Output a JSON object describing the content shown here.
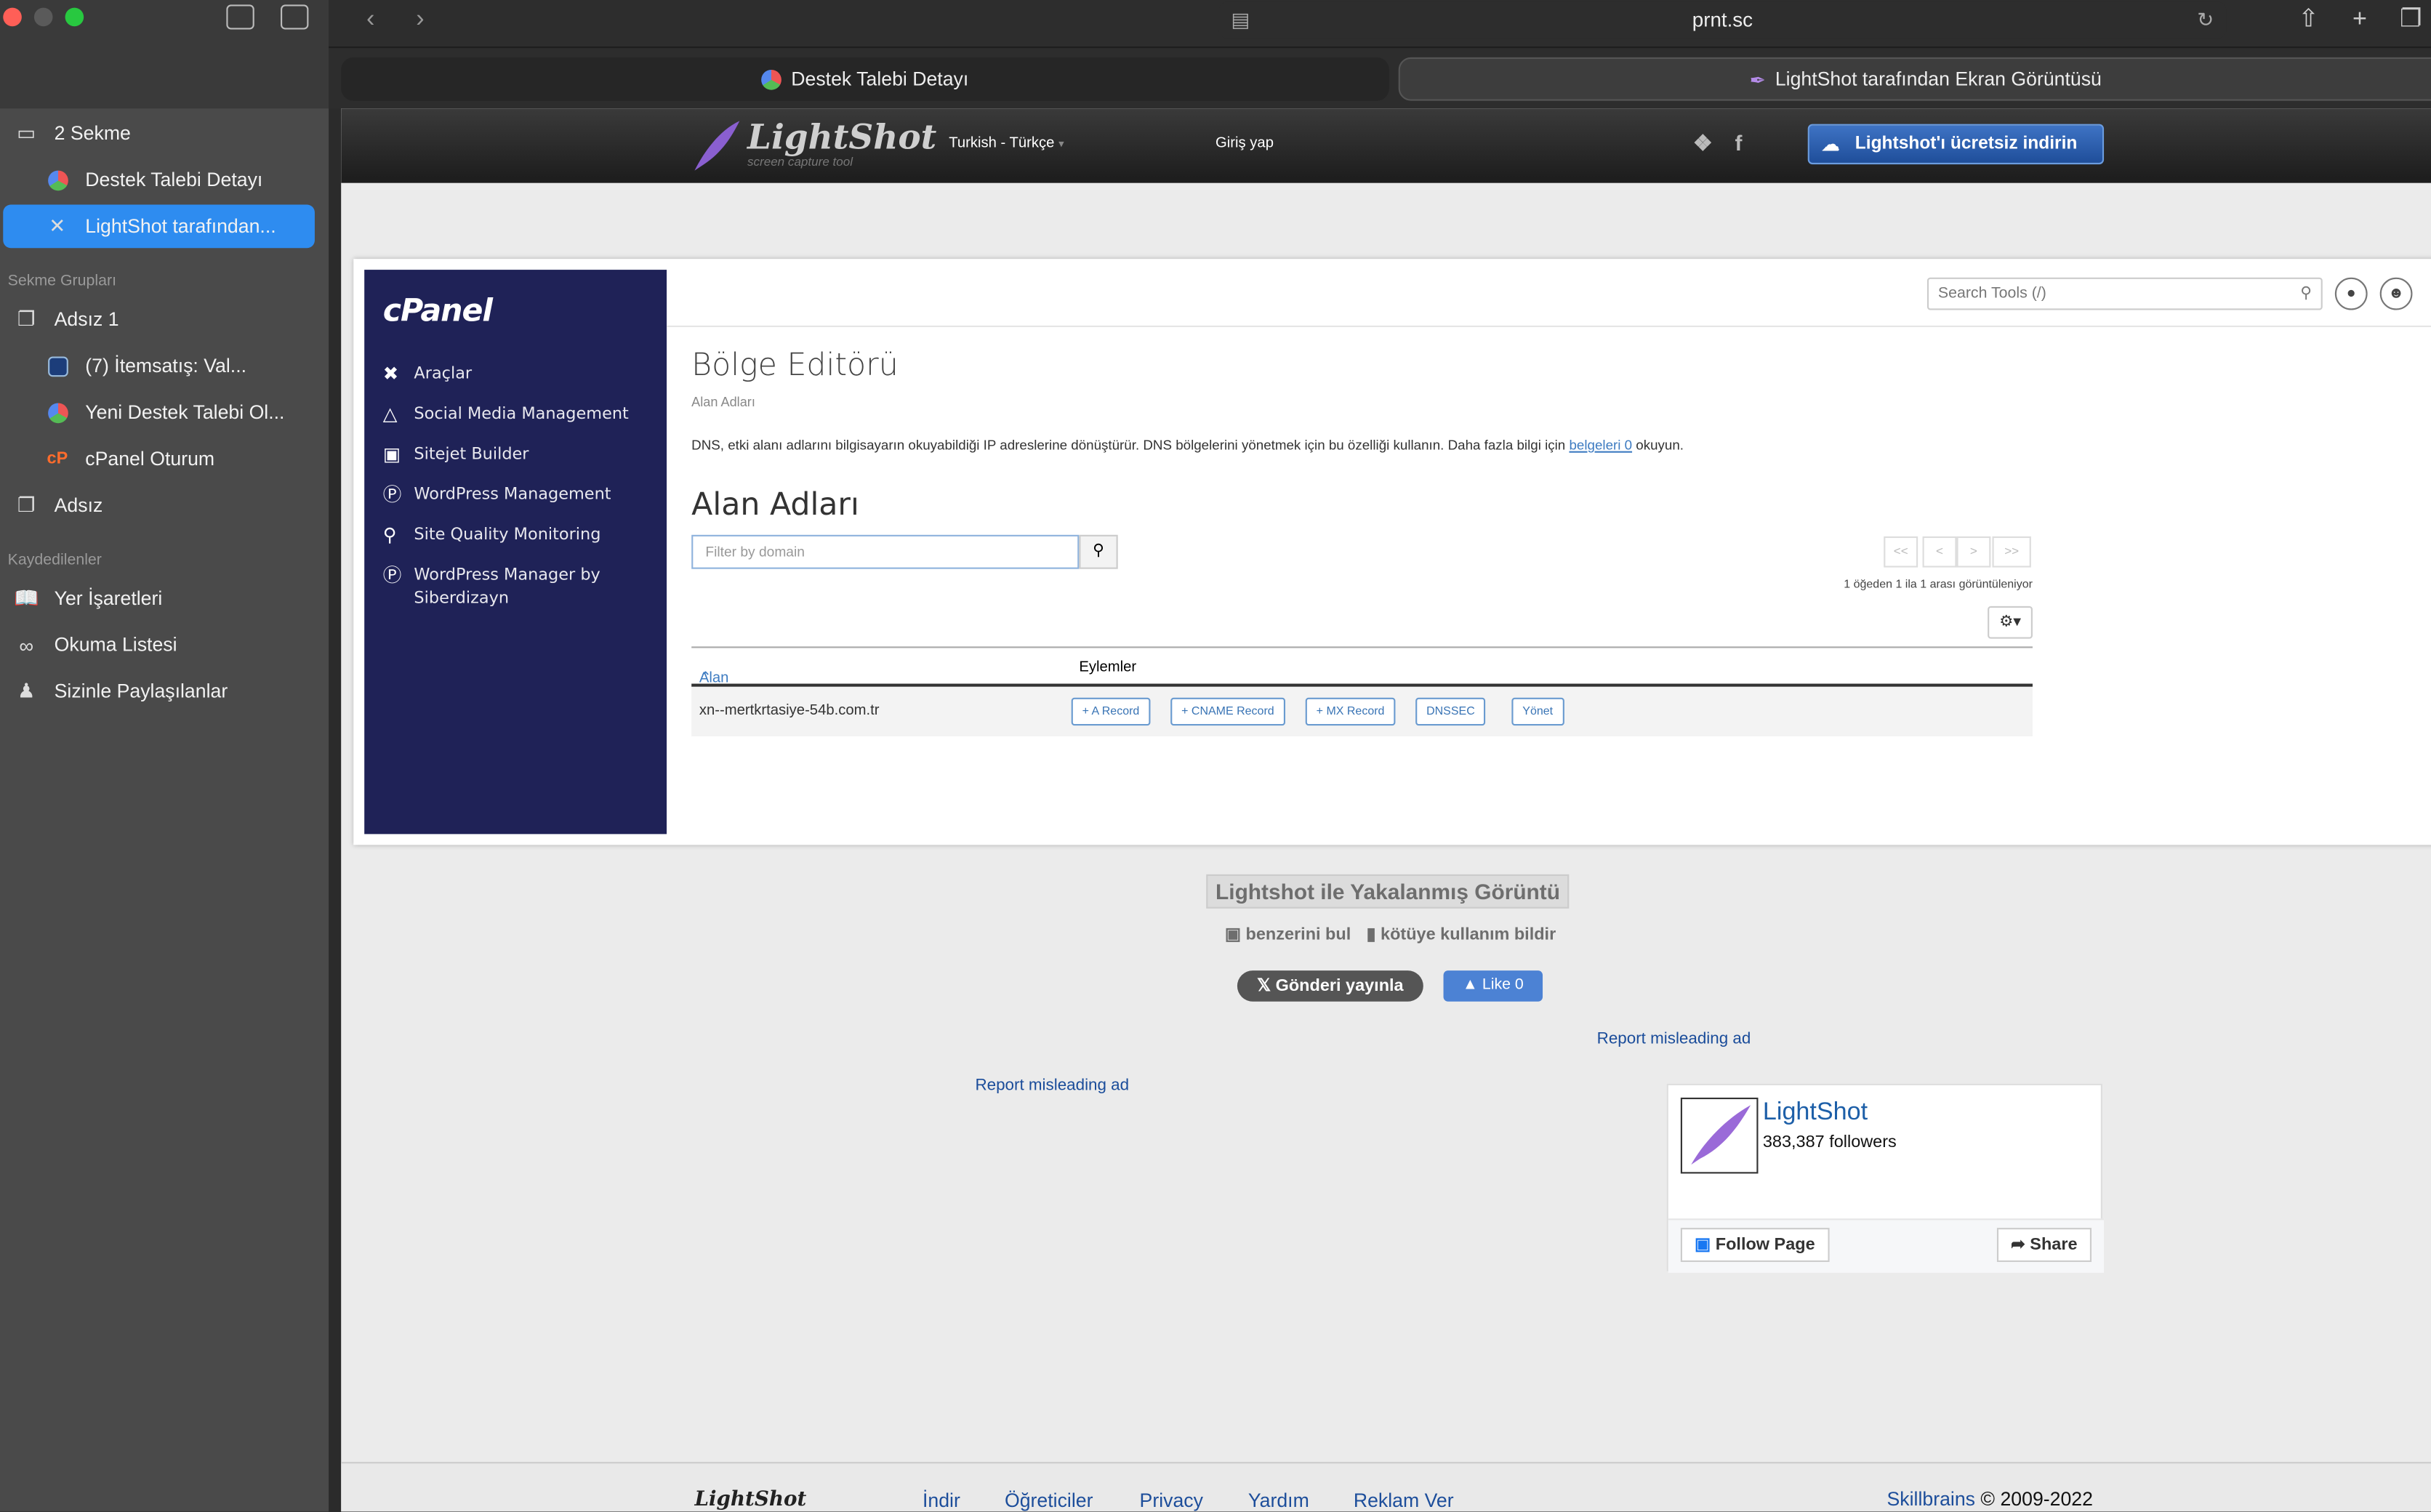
{
  "browser": {
    "url": "prnt.sc",
    "tabs": [
      {
        "label": "Destek Talebi Detayı"
      },
      {
        "label": "LightShot tarafından Ekran Görüntüsü"
      }
    ]
  },
  "sidebar": {
    "tab_count": "2 Sekme",
    "open_tabs": [
      "Destek Talebi Detayı",
      "LightShot tarafından..."
    ],
    "groups_title": "Sekme Grupları",
    "groups": [
      "Adsız 1",
      "(7) İtemsatış: Val...",
      "Yeni Destek Talebi Ol...",
      "cPanel Oturum",
      "Adsız"
    ],
    "saved_title": "Kaydedilenler",
    "saved": [
      "Yer İşaretleri",
      "Okuma Listesi",
      "Sizinle Paylaşılanlar"
    ]
  },
  "lightshot": {
    "logo": "LightShot",
    "tagline": "screen capture tool",
    "language": "Turkish - Türkçe",
    "login": "Giriş yap",
    "download": "Lightshot'ı ücretsiz indirin",
    "caption": "Lightshot ile Yakalanmış Görüntü",
    "find_similar": "benzerini bul",
    "report_abuse": "kötüye kullanım bildir",
    "tweet": "Gönderi yayınla",
    "like": "Like 0",
    "report_ad_1": "Report misleading ad",
    "report_ad_2": "Report misleading ad",
    "fb": {
      "name": "LightShot",
      "followers": "383,387 followers",
      "follow": "Follow Page",
      "share": "Share"
    },
    "footer": {
      "logo": "LightShot",
      "links": [
        "İndir",
        "Öğreticiler",
        "Privacy",
        "Yardım",
        "Reklam Ver"
      ],
      "brand": "Skillbrains",
      "copyright": "© 2009-2022"
    }
  },
  "cpanel": {
    "logo": "cPanel",
    "nav": [
      "Araçlar",
      "Social Media Management",
      "Sitejet Builder",
      "WordPress Management",
      "Site Quality Monitoring",
      "WordPress Manager by Siberdizayn"
    ],
    "search_placeholder": "Search Tools (/)",
    "title": "Bölge Editörü",
    "breadcrumb": "Alan Adları",
    "description": "DNS, etki alanı adlarını bilgisayarın okuyabildiği IP adreslerine dönüştürür. DNS bölgelerini yönetmek için bu özelliği kullanın. Daha fazla bilgi için",
    "doc_link": "belgeleri 0",
    "description_end": "okuyun.",
    "section": "Alan Adları",
    "filter_placeholder": "Filter by domain",
    "pager": [
      "<<",
      "<",
      ">",
      ">>"
    ],
    "count_text": "1 öğeden 1 ila 1 arası görüntüleniyor",
    "col_domain": "Alan Adı",
    "col_actions": "Eylemler",
    "row_domain": "xn--mertkrtasiye-54b.com.tr",
    "actions": [
      "+ A Record",
      "+ CNAME Record",
      "+ MX Record",
      "DNSSEC",
      "Yönet"
    ]
  }
}
